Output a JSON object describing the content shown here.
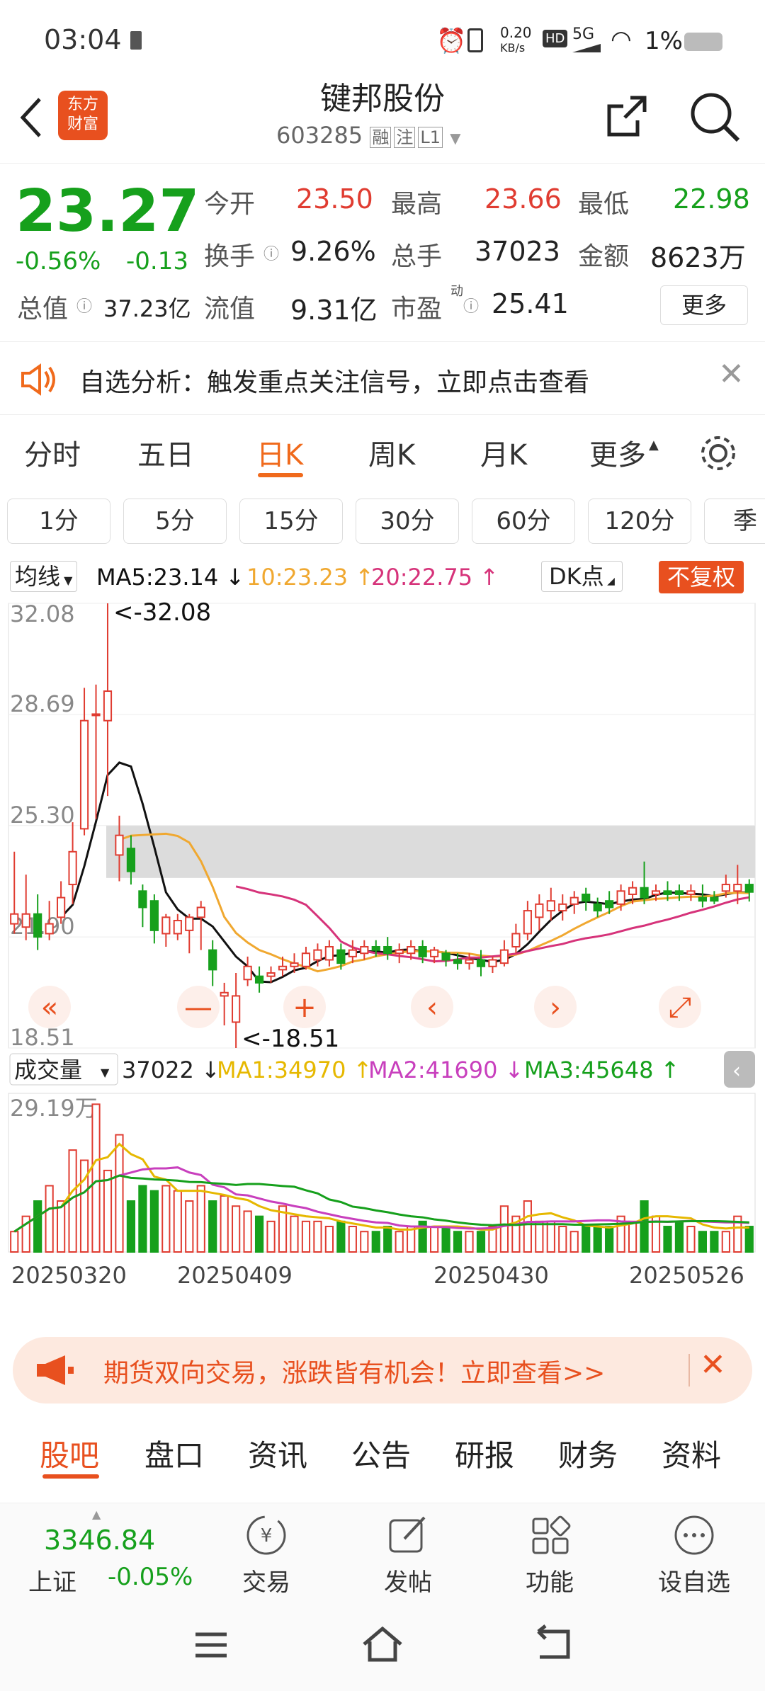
{
  "status_bar": {
    "time": "03:04",
    "net_speed_top": "0.20",
    "net_speed_unit": "KB/s",
    "hd": "HD",
    "signal": "5G",
    "battery": "1%"
  },
  "header": {
    "title": "键邦股份",
    "code": "603285",
    "tags": [
      "融",
      "注",
      "L1"
    ]
  },
  "quote": {
    "price": "23.27",
    "change_pct": "-0.56%",
    "change": "-0.13",
    "open_label": "今开",
    "open": "23.50",
    "high_label": "最高",
    "high": "23.66",
    "low_label": "最低",
    "low": "22.98",
    "turnover_label": "换手",
    "turnover": "9.26%",
    "volume_label": "总手",
    "volume": "37023",
    "amount_label": "金额",
    "amount": "8623万",
    "mktcap_label": "总值",
    "mktcap": "37.23亿",
    "float_label": "流值",
    "float": "9.31亿",
    "pe_label": "市盈",
    "pe_sup": "动",
    "pe": "25.41",
    "more": "更多"
  },
  "notice": {
    "text": "自选分析：触发重点关注信号，立即点击查看"
  },
  "period_tabs": [
    "分时",
    "五日",
    "日K",
    "周K",
    "月K",
    "更多"
  ],
  "kline_tabs": [
    "1分",
    "5分",
    "15分",
    "30分",
    "60分",
    "120分",
    "季"
  ],
  "chart_header": {
    "ma_select": "均线",
    "ma5": "MA5:23.14 ↓",
    "ma10": "10:23.23 ↑",
    "ma20": "20:22.75 ↑",
    "dk": "DK点",
    "fuquan": "不复权"
  },
  "chart_data": {
    "type": "candlestick",
    "y_ticks": [
      "32.08",
      "28.69",
      "25.30",
      "21.90",
      "18.51"
    ],
    "ylim": [
      18.51,
      32.08
    ],
    "annotations": [
      "<-32.08",
      "<-18.51"
    ],
    "candles": [
      {
        "o": 22.3,
        "c": 22.6,
        "h": 24.5,
        "l": 22.0
      },
      {
        "o": 22.2,
        "c": 22.6,
        "h": 23.8,
        "l": 21.8
      },
      {
        "o": 22.6,
        "c": 21.9,
        "h": 23.2,
        "l": 21.5
      },
      {
        "o": 22.0,
        "c": 22.3,
        "h": 23.0,
        "l": 21.8
      },
      {
        "o": 22.5,
        "c": 23.1,
        "h": 23.6,
        "l": 22.3
      },
      {
        "o": 23.5,
        "c": 24.5,
        "h": 25.4,
        "l": 22.9
      },
      {
        "o": 25.2,
        "c": 28.5,
        "h": 29.5,
        "l": 25.0
      },
      {
        "o": 28.7,
        "c": 28.7,
        "h": 29.6,
        "l": 25.5
      },
      {
        "o": 28.5,
        "c": 29.4,
        "h": 32.08,
        "l": 26.2
      },
      {
        "o": 24.4,
        "c": 25.0,
        "h": 25.6,
        "l": 23.6
      },
      {
        "o": 24.6,
        "c": 23.9,
        "h": 25.0,
        "l": 23.5
      },
      {
        "o": 23.3,
        "c": 22.8,
        "h": 23.5,
        "l": 22.2
      },
      {
        "o": 23.0,
        "c": 22.1,
        "h": 23.2,
        "l": 21.7
      },
      {
        "o": 22.0,
        "c": 22.5,
        "h": 22.6,
        "l": 21.6
      },
      {
        "o": 22.0,
        "c": 22.4,
        "h": 22.6,
        "l": 21.8
      },
      {
        "o": 22.1,
        "c": 22.5,
        "h": 22.6,
        "l": 21.4
      },
      {
        "o": 22.5,
        "c": 22.8,
        "h": 23.0,
        "l": 21.5
      },
      {
        "o": 21.5,
        "c": 20.9,
        "h": 21.8,
        "l": 20.4
      },
      {
        "o": 20.1,
        "c": 20.2,
        "h": 20.5,
        "l": 19.2
      },
      {
        "o": 19.3,
        "c": 20.1,
        "h": 20.8,
        "l": 18.51
      },
      {
        "o": 20.6,
        "c": 21.0,
        "h": 21.3,
        "l": 20.4
      },
      {
        "o": 20.7,
        "c": 20.5,
        "h": 21.0,
        "l": 20.2
      },
      {
        "o": 20.7,
        "c": 20.8,
        "h": 21.0,
        "l": 20.5
      },
      {
        "o": 20.9,
        "c": 21.0,
        "h": 21.3,
        "l": 20.7
      },
      {
        "o": 21.0,
        "c": 21.1,
        "h": 21.4,
        "l": 20.8
      },
      {
        "o": 21.0,
        "c": 21.4,
        "h": 21.6,
        "l": 20.9
      },
      {
        "o": 21.2,
        "c": 21.5,
        "h": 21.7,
        "l": 21.0
      },
      {
        "o": 21.2,
        "c": 21.6,
        "h": 21.8,
        "l": 21.0
      },
      {
        "o": 21.5,
        "c": 21.1,
        "h": 21.7,
        "l": 20.9
      },
      {
        "o": 21.3,
        "c": 21.5,
        "h": 21.8,
        "l": 21.1
      },
      {
        "o": 21.4,
        "c": 21.6,
        "h": 21.8,
        "l": 21.2
      },
      {
        "o": 21.6,
        "c": 21.5,
        "h": 21.8,
        "l": 21.3
      },
      {
        "o": 21.6,
        "c": 21.4,
        "h": 21.9,
        "l": 21.2
      },
      {
        "o": 21.4,
        "c": 21.5,
        "h": 21.7,
        "l": 21.1
      },
      {
        "o": 21.4,
        "c": 21.6,
        "h": 21.8,
        "l": 21.2
      },
      {
        "o": 21.6,
        "c": 21.3,
        "h": 21.8,
        "l": 21.1
      },
      {
        "o": 21.3,
        "c": 21.5,
        "h": 21.6,
        "l": 21.1
      },
      {
        "o": 21.4,
        "c": 21.2,
        "h": 21.5,
        "l": 21.0
      },
      {
        "o": 21.2,
        "c": 21.1,
        "h": 21.4,
        "l": 20.9
      },
      {
        "o": 21.1,
        "c": 21.2,
        "h": 21.4,
        "l": 20.9
      },
      {
        "o": 21.2,
        "c": 21.0,
        "h": 21.5,
        "l": 20.7
      },
      {
        "o": 21.0,
        "c": 21.2,
        "h": 21.3,
        "l": 20.8
      },
      {
        "o": 21.1,
        "c": 21.5,
        "h": 21.8,
        "l": 21.0
      },
      {
        "o": 21.6,
        "c": 22.0,
        "h": 22.3,
        "l": 21.4
      },
      {
        "o": 22.0,
        "c": 22.7,
        "h": 23.0,
        "l": 21.8
      },
      {
        "o": 22.5,
        "c": 22.9,
        "h": 23.2,
        "l": 22.1
      },
      {
        "o": 22.7,
        "c": 23.0,
        "h": 23.4,
        "l": 22.4
      },
      {
        "o": 22.7,
        "c": 22.9,
        "h": 23.2,
        "l": 22.4
      },
      {
        "o": 22.9,
        "c": 23.1,
        "h": 23.3,
        "l": 22.6
      },
      {
        "o": 23.2,
        "c": 23.0,
        "h": 23.4,
        "l": 22.7
      },
      {
        "o": 22.9,
        "c": 22.7,
        "h": 23.1,
        "l": 22.5
      },
      {
        "o": 23.0,
        "c": 22.8,
        "h": 23.3,
        "l": 22.6
      },
      {
        "o": 22.9,
        "c": 23.3,
        "h": 23.5,
        "l": 22.7
      },
      {
        "o": 23.2,
        "c": 23.4,
        "h": 23.6,
        "l": 22.9
      },
      {
        "o": 23.4,
        "c": 23.1,
        "h": 24.2,
        "l": 22.9
      },
      {
        "o": 23.2,
        "c": 23.3,
        "h": 23.5,
        "l": 23.0
      },
      {
        "o": 23.3,
        "c": 23.2,
        "h": 23.6,
        "l": 23.0
      },
      {
        "o": 23.3,
        "c": 23.2,
        "h": 23.5,
        "l": 23.0
      },
      {
        "o": 23.2,
        "c": 23.3,
        "h": 23.5,
        "l": 23.0
      },
      {
        "o": 23.1,
        "c": 23.0,
        "h": 23.5,
        "l": 22.8
      },
      {
        "o": 23.1,
        "c": 23.0,
        "h": 23.3,
        "l": 22.9
      },
      {
        "o": 23.3,
        "c": 23.5,
        "h": 23.8,
        "l": 23.1
      },
      {
        "o": 23.3,
        "c": 23.5,
        "h": 24.1,
        "l": 22.9
      },
      {
        "o": 23.5,
        "c": 23.27,
        "h": 23.66,
        "l": 22.98
      }
    ],
    "volume_header": {
      "label": "成交量",
      "vol": "37022 ↓",
      "ma1": "MA1:34970 ↑",
      "ma2": "MA2:41690 ↓",
      "ma3": "MA3:45648 ↑"
    },
    "volume_top_label": "29.19万",
    "volumes": [
      4,
      7,
      10,
      13,
      10,
      20,
      18,
      29,
      16,
      23,
      10,
      13,
      12,
      13,
      12,
      10,
      13,
      10,
      11,
      9,
      8,
      7,
      6,
      9,
      7,
      6,
      6,
      5,
      6,
      5,
      4,
      4,
      5,
      4,
      5,
      6,
      5,
      5,
      4,
      4,
      4,
      5,
      9,
      7,
      10,
      6,
      6,
      5,
      4,
      5,
      5,
      5,
      7,
      6,
      10,
      7,
      5,
      6,
      5,
      4,
      4,
      4,
      7,
      5
    ],
    "x_dates": [
      "20250320",
      "20250409",
      "20250430",
      "20250526"
    ]
  },
  "banner": {
    "text": "期货双向交易，涨跌皆有机会！立即查看>>"
  },
  "bottom_tabs": [
    "股吧",
    "盘口",
    "资讯",
    "公告",
    "研报",
    "财务",
    "资料"
  ],
  "bottom_bar": {
    "index_value": "3346.84",
    "index_name": "上证",
    "index_change": "-0.05%",
    "items": [
      "交易",
      "发帖",
      "功能",
      "设自选"
    ]
  },
  "colors": {
    "up": "#e03c31",
    "down": "#16a01c",
    "accent": "#f06a1c",
    "ma5": "#111111",
    "ma10": "#f0a830",
    "ma20": "#d6337a"
  }
}
